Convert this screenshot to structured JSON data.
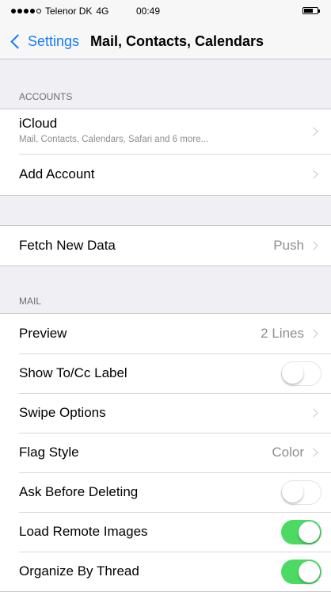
{
  "status_bar": {
    "carrier": "Telenor DK",
    "network": "4G",
    "time": "00:49"
  },
  "nav": {
    "back_label": "Settings",
    "title": "Mail, Contacts, Calendars"
  },
  "accounts": {
    "header": "ACCOUNTS",
    "icloud": {
      "label": "iCloud",
      "subtitle": "Mail, Contacts, Calendars, Safari and 6 more..."
    },
    "add_account": "Add Account"
  },
  "fetch": {
    "label": "Fetch New Data",
    "value": "Push"
  },
  "mail": {
    "header": "MAIL",
    "preview": {
      "label": "Preview",
      "value": "2 Lines"
    },
    "show_to_cc": {
      "label": "Show To/Cc Label",
      "enabled": false
    },
    "swipe_options": {
      "label": "Swipe Options"
    },
    "flag_style": {
      "label": "Flag Style",
      "value": "Color"
    },
    "ask_before_deleting": {
      "label": "Ask Before Deleting",
      "enabled": false
    },
    "load_remote_images": {
      "label": "Load Remote Images",
      "enabled": true
    },
    "organize_by_thread": {
      "label": "Organize By Thread",
      "enabled": true
    }
  },
  "colors": {
    "accent": "#1a7bf5",
    "toggle_on": "#4cd964",
    "background": "#efeff4"
  }
}
